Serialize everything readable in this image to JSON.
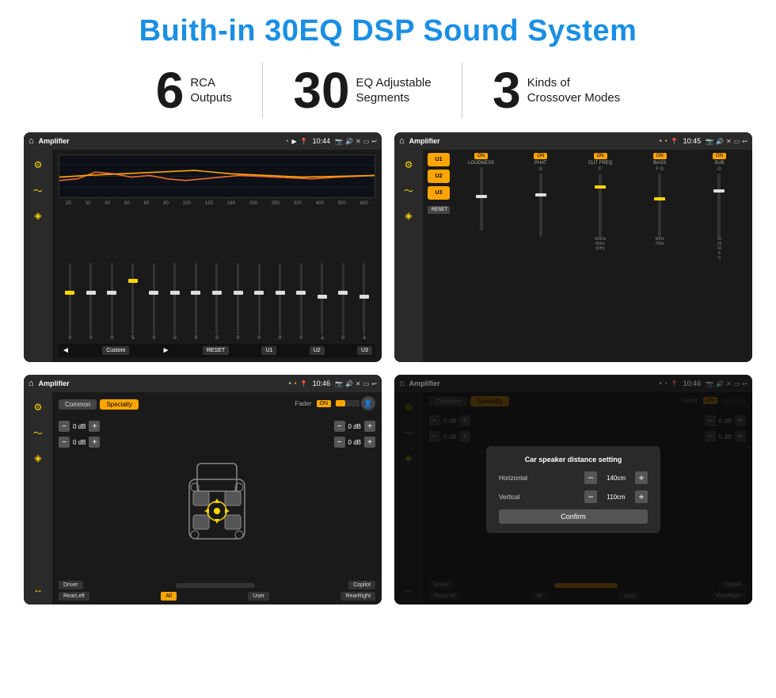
{
  "title": "Buith-in 30EQ DSP Sound System",
  "stats": [
    {
      "number": "6",
      "desc_line1": "RCA",
      "desc_line2": "Outputs"
    },
    {
      "number": "30",
      "desc_line1": "EQ Adjustable",
      "desc_line2": "Segments"
    },
    {
      "number": "3",
      "desc_line1": "Kinds of",
      "desc_line2": "Crossover Modes"
    }
  ],
  "screens": [
    {
      "id": "eq-screen",
      "topbar": {
        "title": "Amplifier",
        "time": "10:44"
      },
      "type": "eq",
      "eq_labels": [
        "25",
        "32",
        "40",
        "50",
        "63",
        "80",
        "100",
        "125",
        "160",
        "200",
        "250",
        "320",
        "400",
        "500",
        "630"
      ],
      "eq_values": [
        "0",
        "0",
        "0",
        "5",
        "0",
        "0",
        "0",
        "0",
        "0",
        "0",
        "0",
        "0",
        "-1",
        "0",
        "-1"
      ],
      "bottom_buttons": [
        "Custom",
        "RESET",
        "U1",
        "U2",
        "U3"
      ]
    },
    {
      "id": "crossover-screen",
      "topbar": {
        "title": "Amplifier",
        "time": "10:45"
      },
      "type": "crossover",
      "presets": [
        "U1",
        "U2",
        "U3"
      ],
      "channels": [
        {
          "label": "LOUDNESS",
          "on": true
        },
        {
          "label": "PHAT",
          "on": true
        },
        {
          "label": "CUT FREQ",
          "on": true
        },
        {
          "label": "BASS",
          "on": true
        },
        {
          "label": "SUB",
          "on": true
        }
      ]
    },
    {
      "id": "balance-screen",
      "topbar": {
        "title": "Amplifier",
        "time": "10:46"
      },
      "type": "balance",
      "tabs": [
        "Common",
        "Specialty"
      ],
      "active_tab": 1,
      "fader_label": "Fader",
      "fader_on": true,
      "volumes": [
        {
          "pos": "top-left",
          "val": "0 dB"
        },
        {
          "pos": "top-right",
          "val": "0 dB"
        },
        {
          "pos": "bot-left",
          "val": "0 dB"
        },
        {
          "pos": "bot-right",
          "val": "0 dB"
        }
      ],
      "bottom_buttons": [
        "Driver",
        "Copilot",
        "RearLeft",
        "All",
        "User",
        "RearRight"
      ]
    },
    {
      "id": "dialog-screen",
      "topbar": {
        "title": "Amplifier",
        "time": "10:46"
      },
      "type": "dialog",
      "dialog": {
        "title": "Car speaker distance setting",
        "fields": [
          {
            "label": "Horizontal",
            "value": "140cm"
          },
          {
            "label": "Vertical",
            "value": "110cm"
          }
        ],
        "confirm_label": "Confirm"
      },
      "side_volumes": [
        "0 dB",
        "0 dB"
      ],
      "bottom_buttons": [
        "Driver",
        "Copilot",
        "RearLeft",
        "All",
        "User",
        "RearRight"
      ]
    }
  ]
}
